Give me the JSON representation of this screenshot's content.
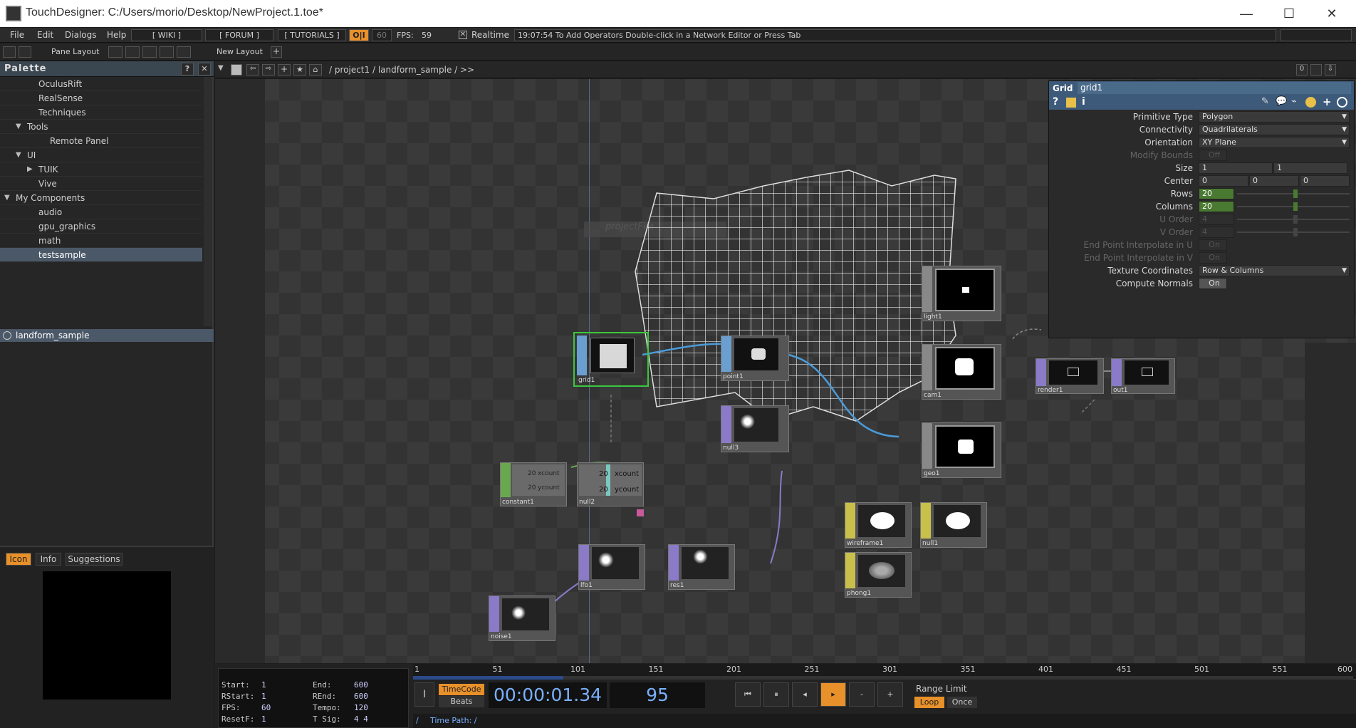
{
  "window": {
    "title": "TouchDesigner: C:/Users/morio/Desktop/NewProject.1.toe*",
    "minimize": "—",
    "maximize": "☐",
    "close": "✕"
  },
  "menu": {
    "items": [
      "File",
      "Edit",
      "Dialogs",
      "Help"
    ],
    "wiki": "[ WIKI ]",
    "forum": "[ FORUM ]",
    "tutorials": "[ TUTORIALS ]",
    "oi": "O|I",
    "fps_cap": "60",
    "fps_label": "FPS:",
    "fps_value": "59",
    "realtime": "Realtime",
    "status": "19:07:54 To Add Operators Double-click in a Network Editor or Press Tab"
  },
  "layout": {
    "pane_layout": "Pane Layout",
    "new_layout": "New Layout"
  },
  "palette": {
    "title": "Palette",
    "help": "?",
    "close": "✕",
    "items": [
      {
        "label": "OculusRift",
        "indent": 2
      },
      {
        "label": "RealSense",
        "indent": 2
      },
      {
        "label": "Techniques",
        "indent": 2
      },
      {
        "label": "Tools",
        "indent": 1,
        "arrow": "▼"
      },
      {
        "label": "Remote Panel",
        "indent": 3
      },
      {
        "label": "UI",
        "indent": 1,
        "arrow": "▼"
      },
      {
        "label": "TUIK",
        "indent": 2,
        "arrow": "▶"
      },
      {
        "label": "Vive",
        "indent": 2
      },
      {
        "label": "My Components",
        "indent": 0,
        "arrow": "▼"
      },
      {
        "label": "audio",
        "indent": 2
      },
      {
        "label": "gpu_graphics",
        "indent": 2
      },
      {
        "label": "math",
        "indent": 2
      },
      {
        "label": "testsample",
        "indent": 2,
        "selected": true
      }
    ],
    "component": "landform_sample",
    "tabs": [
      "Icon",
      "Info",
      "Suggestions"
    ]
  },
  "network": {
    "path": [
      "/",
      "project1",
      "/",
      "landform_sample",
      "/",
      ">>"
    ],
    "path_text": "/ project1 / landform_sample / >>",
    "ghost": "projectFile",
    "nodes": {
      "grid1": "grid1",
      "point": "point1",
      "null3": "null3",
      "light1": "light1",
      "cam1": "cam1",
      "geo1": "geo1",
      "render1": "render1",
      "out1": "out1",
      "constant1": "constant1",
      "null2": "null2",
      "lfo1": "lfo1",
      "res1": "res1",
      "noise1": "noise1",
      "wireframe1": "wireframe1",
      "null1": "null1",
      "phong1": "phong1"
    },
    "const_vals": [
      "20",
      "20"
    ],
    "const_names": [
      "xcount",
      "ycount"
    ],
    "null2_vals": [
      "20",
      "20"
    ],
    "null2_names": [
      "xcount",
      "ycount"
    ]
  },
  "params": {
    "op_type": "Grid",
    "op_name": "grid1",
    "rows": [
      {
        "label": "Primitive Type",
        "value": "Polygon",
        "kind": "menu"
      },
      {
        "label": "Connectivity",
        "value": "Quadrilaterals",
        "kind": "menu"
      },
      {
        "label": "Orientation",
        "value": "XY Plane",
        "kind": "menu"
      },
      {
        "label": "Modify Bounds",
        "value": "Off",
        "kind": "toggle",
        "disabled": true
      },
      {
        "label": "Size",
        "values": [
          "1",
          "1"
        ],
        "kind": "multi"
      },
      {
        "label": "Center",
        "values": [
          "0",
          "0",
          "0"
        ],
        "kind": "multi"
      },
      {
        "label": "Rows",
        "value": "20",
        "kind": "slider"
      },
      {
        "label": "Columns",
        "value": "20",
        "kind": "slider"
      },
      {
        "label": "U Order",
        "value": "4",
        "kind": "slider",
        "disabled": true
      },
      {
        "label": "V Order",
        "value": "4",
        "kind": "slider",
        "disabled": true
      },
      {
        "label": "End Point Interpolate in U",
        "value": "On",
        "kind": "toggle",
        "disabled": true
      },
      {
        "label": "End Point Interpolate in V",
        "value": "On",
        "kind": "toggle",
        "disabled": true
      },
      {
        "label": "Texture Coordinates",
        "value": "Row & Columns",
        "kind": "menu"
      },
      {
        "label": "Compute Normals",
        "value": "On",
        "kind": "toggle"
      }
    ]
  },
  "timeline": {
    "info": [
      [
        "Start:",
        "1",
        "End:",
        "600"
      ],
      [
        "RStart:",
        "1",
        "REnd:",
        "600"
      ],
      [
        "FPS:",
        "60",
        "Tempo:",
        "120"
      ],
      [
        "ResetF:",
        "1",
        "T Sig:",
        "4   4"
      ]
    ],
    "ticks": [
      "1",
      "51",
      "101",
      "151",
      "201",
      "251",
      "301",
      "351",
      "401",
      "451",
      "501",
      "551",
      "600"
    ],
    "timecode": "TimeCode",
    "beats": "Beats",
    "time": "00:00:01.34",
    "frame": "95",
    "range_limit": "Range Limit",
    "loop": "Loop",
    "once": "Once",
    "time_path": "Time Path: /",
    "minus": "-",
    "plus": "+",
    "progress": 0.16
  },
  "colors": {
    "accent": "#e8902a",
    "selected": "#4b5868",
    "sop": "#6a9fd0",
    "top": "#8a7ac8",
    "chop": "#6aa84f",
    "comp": "#9a9a9a",
    "mat": "#c8c04a"
  }
}
